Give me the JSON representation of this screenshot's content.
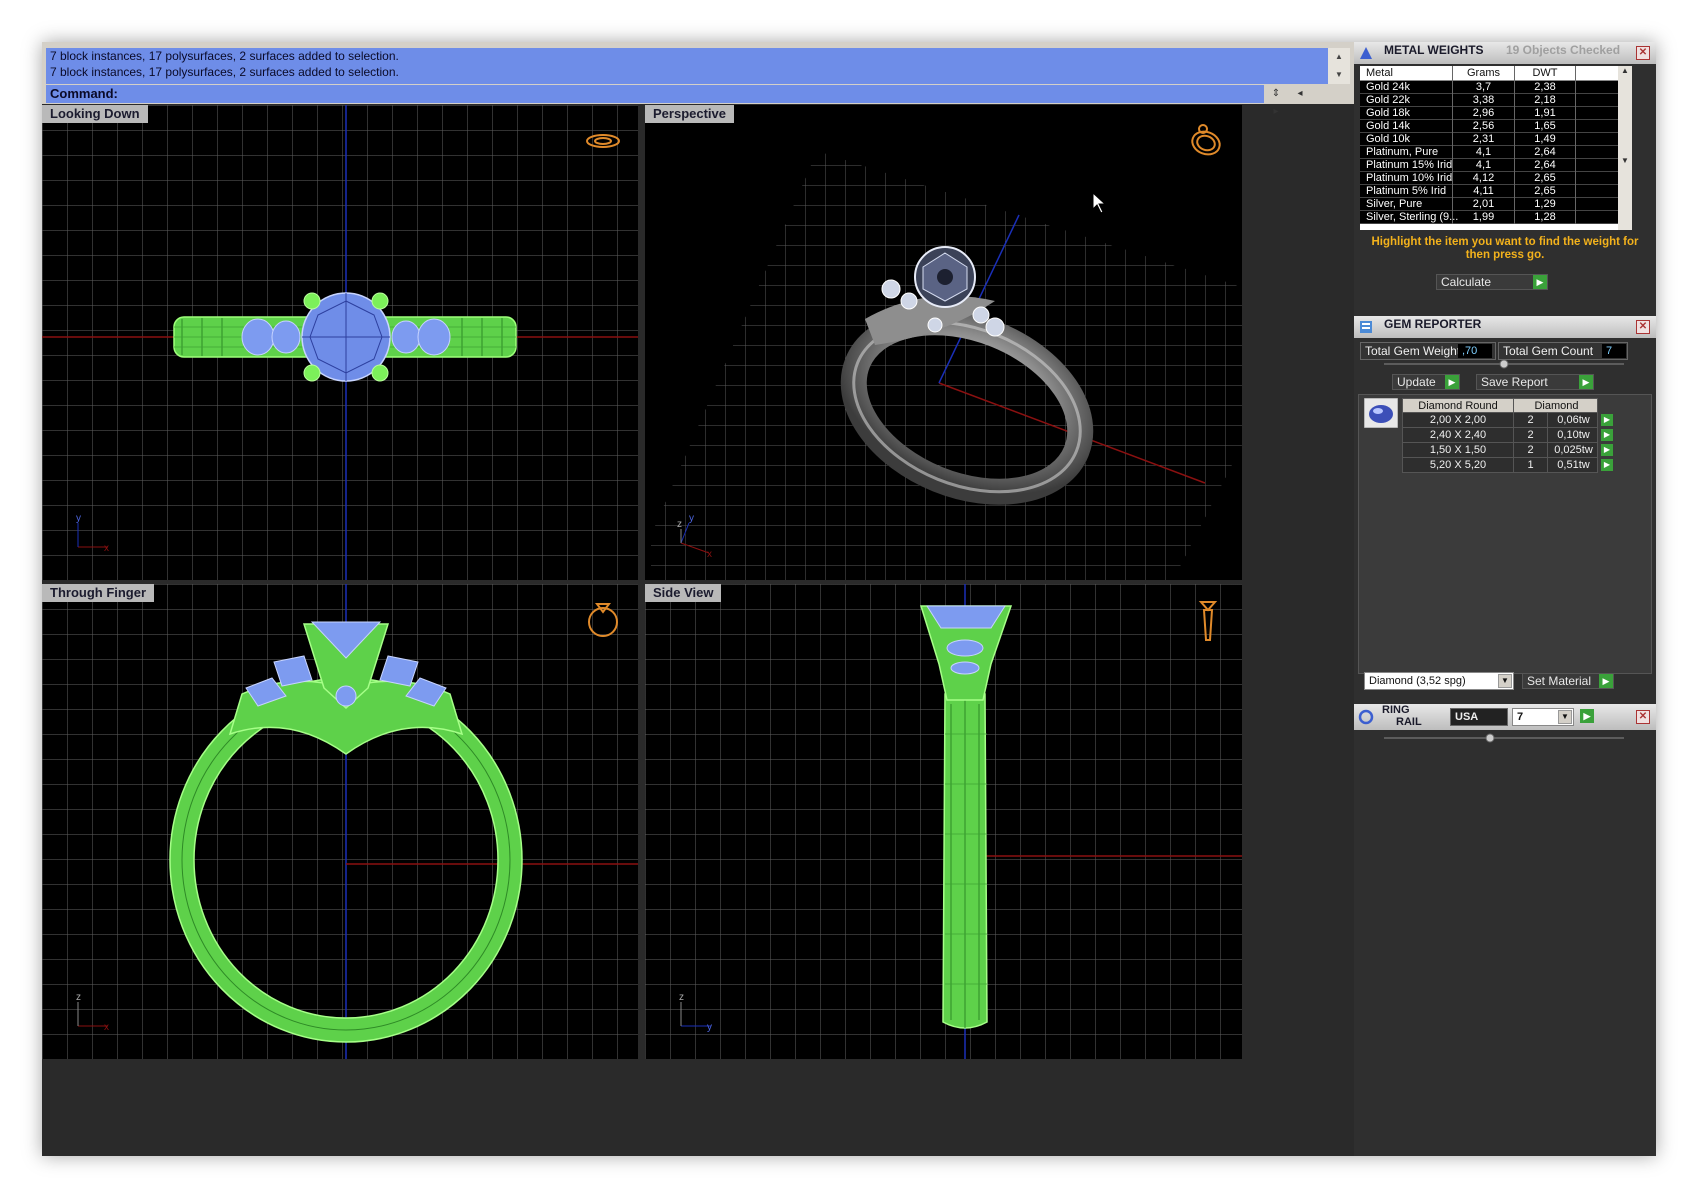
{
  "command": {
    "history": [
      "7 block instances, 17 polysurfaces, 2 surfaces added to selection.",
      "7 block instances, 17 polysurfaces, 2 surfaces added to selection."
    ],
    "prompt": "Command:",
    "input_value": ""
  },
  "viewports": {
    "top_left": "Looking Down",
    "top_right": "Perspective",
    "bottom_left": "Through Finger",
    "bottom_right": "Side View"
  },
  "axes": {
    "x": "x",
    "y": "y",
    "z": "z"
  },
  "metal_weights": {
    "title": "METAL WEIGHTS",
    "status": "19 Objects Checked",
    "headers": [
      "Metal",
      "Grams",
      "DWT"
    ],
    "rows": [
      [
        "Gold 24k",
        "3,7",
        "2,38"
      ],
      [
        "Gold 22k",
        "3,38",
        "2,18"
      ],
      [
        "Gold 18k",
        "2,96",
        "1,91"
      ],
      [
        "Gold 14k",
        "2,56",
        "1,65"
      ],
      [
        "Gold 10k",
        "2,31",
        "1,49"
      ],
      [
        "Platinum, Pure",
        "4,1",
        "2,64"
      ],
      [
        "Platinum 15% Irid",
        "4,1",
        "2,64"
      ],
      [
        "Platinum 10% Irid",
        "4,12",
        "2,65"
      ],
      [
        "Platinum 5% Irid",
        "4,11",
        "2,65"
      ],
      [
        "Silver, Pure",
        "2,01",
        "1,29"
      ],
      [
        "Silver, Sterling (9...",
        "1,99",
        "1,28"
      ]
    ],
    "hint": "Highlight the item you want to find the weight for then press go.",
    "calculate_label": "Calculate"
  },
  "gem_reporter": {
    "title": "GEM REPORTER",
    "total_weight_label": "Total Gem Weight",
    "total_weight_value": ",70",
    "total_count_label": "Total Gem Count",
    "total_count_value": "7",
    "update_label": "Update",
    "save_label": "Save Report",
    "table_header": [
      "Diamond Round",
      "Diamond"
    ],
    "rows": [
      [
        "2,00 X 2,00",
        "2",
        "0,06tw"
      ],
      [
        "2,40 X 2,40",
        "2",
        "0,10tw"
      ],
      [
        "1,50 X 1,50",
        "2",
        "0,025tw"
      ],
      [
        "5,20 X 5,20",
        "1",
        "0,51tw"
      ]
    ],
    "material_value": "Diamond    (3,52 spg)",
    "set_material_label": "Set Material"
  },
  "ring_rail": {
    "title_line1": "RING",
    "title_line2": "RAIL",
    "country_value": "USA",
    "size_value": "7"
  },
  "colors": {
    "wire_green": "#7cf05a",
    "wire_blue": "#7d9bf0",
    "command_blue": "#6e8de8",
    "hint_orange": "#f3b21c",
    "go_green": "#3aa13a"
  }
}
